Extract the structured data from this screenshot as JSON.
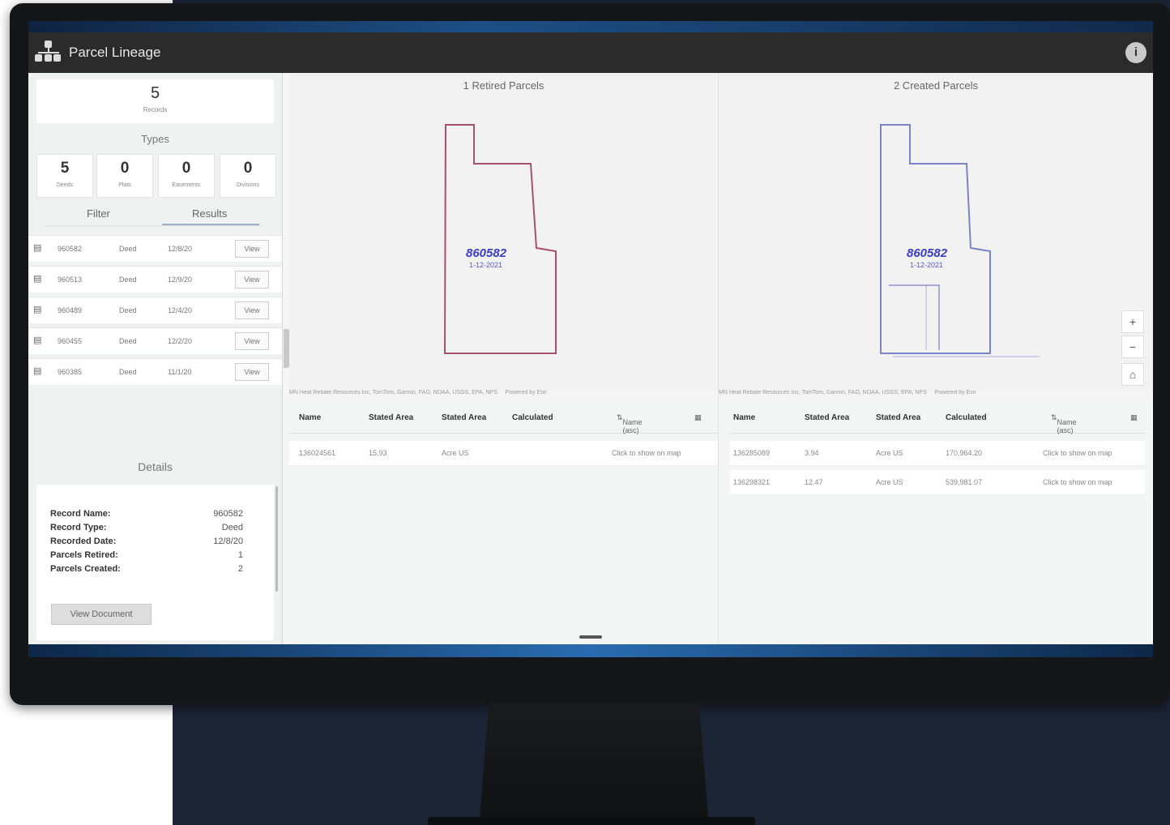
{
  "app": {
    "title": "Parcel Lineage",
    "info_icon": "info-icon"
  },
  "summary": {
    "records_count": "5",
    "records_label": "Records"
  },
  "types": {
    "title": "Types",
    "cards": [
      {
        "count": "5",
        "label": "Deeds"
      },
      {
        "count": "0",
        "label": "Plats"
      },
      {
        "count": "0",
        "label": "Easements"
      },
      {
        "count": "0",
        "label": "Divisions"
      }
    ]
  },
  "tabs": {
    "filter": "Filter",
    "results": "Results"
  },
  "records": [
    {
      "name": "960582",
      "type": "Deed",
      "date": "12/8/20",
      "action": "View"
    },
    {
      "name": "960513",
      "type": "Deed",
      "date": "12/9/20",
      "action": "View"
    },
    {
      "name": "960489",
      "type": "Deed",
      "date": "12/4/20",
      "action": "View"
    },
    {
      "name": "960455",
      "type": "Deed",
      "date": "12/2/20",
      "action": "View"
    },
    {
      "name": "960385",
      "type": "Deed",
      "date": "11/1/20",
      "action": "View"
    }
  ],
  "details": {
    "title": "Details",
    "rows": [
      {
        "key": "Record Name:",
        "value": "960582"
      },
      {
        "key": "Record Type:",
        "value": "Deed"
      },
      {
        "key": "Recorded Date:",
        "value": "12/8/20"
      },
      {
        "key": "Parcels Retired:",
        "value": "1"
      },
      {
        "key": "Parcels Created:",
        "value": "2"
      }
    ],
    "button": "View Document"
  },
  "maps": {
    "retired": {
      "title": "1 Retired Parcels",
      "label_id": "860582",
      "label_date": "1-12-2021"
    },
    "created": {
      "title": "2 Created Parcels",
      "label_id": "860582",
      "label_date": "1-12-2021"
    },
    "attribution": "MN Heat Rebate Resources Inc, TomTom, Garmin, FAO, NOAA, USGS, EPA, NPS",
    "powered": "Powered by Esri"
  },
  "colors": {
    "retired_outline": "#8a1d3c",
    "created_outline": "#4a56b8"
  },
  "retired_table": {
    "headers": [
      "Name",
      "Stated Area",
      "Stated Area",
      "Calculated"
    ],
    "sort_label": "Name (asc)",
    "rows": [
      {
        "name": "136024561",
        "area": "15.93",
        "unit": "Acre US",
        "calc": "",
        "link": "Click to show on map"
      }
    ]
  },
  "created_table": {
    "headers": [
      "Name",
      "Stated Area",
      "Stated Area",
      "Calculated"
    ],
    "sort_label": "Name (asc)",
    "rows": [
      {
        "name": "136285089",
        "area": "3.94",
        "unit": "Acre US",
        "calc": "170,964.20",
        "link": "Click to show on map"
      },
      {
        "name": "136298321",
        "area": "12.47",
        "unit": "Acre US",
        "calc": "539,981.07",
        "link": "Click to show on map"
      }
    ]
  }
}
